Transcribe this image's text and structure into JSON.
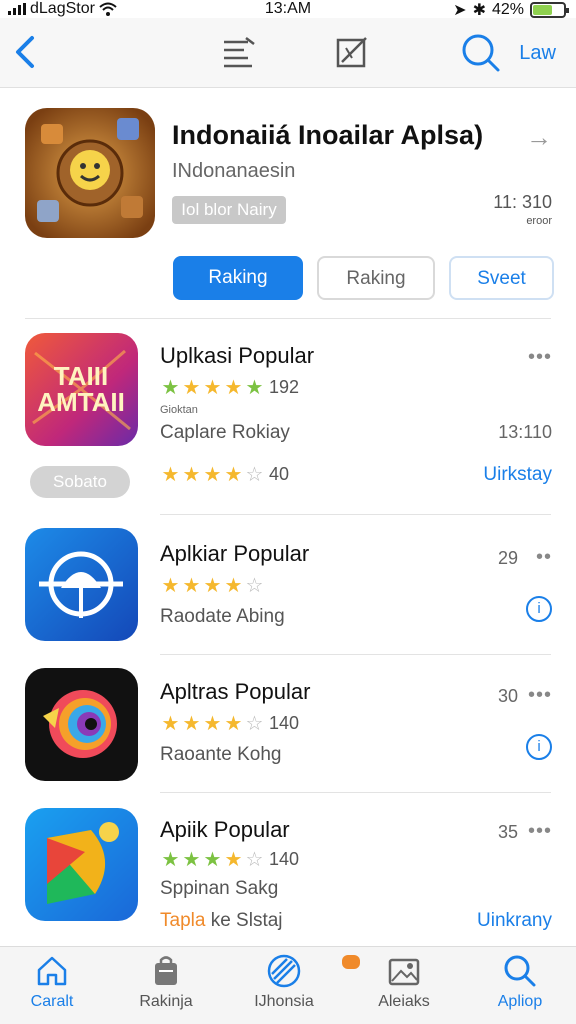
{
  "status_bar": {
    "carrier": "dLagStor",
    "time": "13:AM",
    "battery": "42%"
  },
  "nav": {
    "right_link": "Law"
  },
  "featured": {
    "title": "Indonaiiá Inoailar Aplsa)",
    "subtitle": "INdonanaesin",
    "tag": "Iol blor Nairy",
    "meta_value": "11: 310",
    "meta_small": "eroor",
    "buttons": {
      "primary": "Raking",
      "secondary": "Raking",
      "tertiary": "Sveet"
    }
  },
  "apps": [
    {
      "name": "Uplkasi Popular",
      "icon_text": "TAIII AMTAII",
      "rating_stars": 4.5,
      "rating_count": "192",
      "tiny": "Gioktan",
      "subtitle": "Caplare Rokiay",
      "right_value": "13:110",
      "pill": "Sobato",
      "rating2_stars": 4,
      "rating2_count": "40",
      "link": "Uirkstay"
    },
    {
      "name": "Aplkiar Popular",
      "rating_stars": 4.5,
      "rating_count": "",
      "subtitle": "Raodate Abing",
      "right_value": "29",
      "info": "i"
    },
    {
      "name": "Apltras Popular",
      "rating_stars": 4,
      "rating_count": "140",
      "subtitle": "Raoante Kohg",
      "right_value": "30",
      "info": "i"
    },
    {
      "name": "Apiik Popular",
      "rating_stars": 4.5,
      "rating_count": "140",
      "subtitle": "Sppinan Sakg",
      "orange_text": "Tapla",
      "subtitle2_rest": " ke Slstaj",
      "right_value": "35",
      "link": "Uinkrany"
    }
  ],
  "tabs": [
    {
      "label": "Caralt",
      "icon": "home-icon"
    },
    {
      "label": "Rakinja",
      "icon": "bag-icon"
    },
    {
      "label": "IJhonsia",
      "icon": "compass-icon"
    },
    {
      "label": "Aleiaks",
      "icon": "image-icon"
    },
    {
      "label": "Apliop",
      "icon": "search-icon"
    }
  ],
  "colors": {
    "accent": "#1a7fe8",
    "star_gold": "#f5b82e",
    "star_green": "#7cc242",
    "badge": "#f08a2a"
  }
}
